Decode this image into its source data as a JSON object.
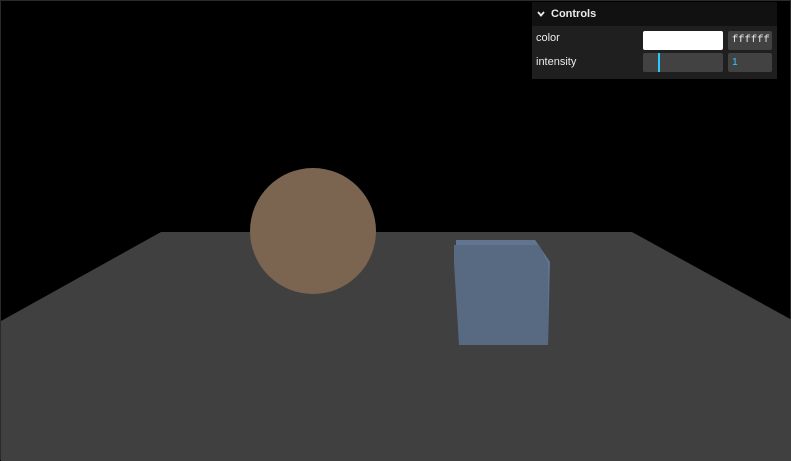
{
  "scene": {
    "background_color": "#000000",
    "floor": {
      "pattern": "checkerboard",
      "light_color": "#737373",
      "dark_color": "#404040"
    },
    "sphere": {
      "color": "#7b6450"
    },
    "cube": {
      "front_color": "#576a82",
      "side_color": "#5f7390",
      "top_color": "#617591"
    }
  },
  "gui": {
    "title": "Controls",
    "collapse_icon": "chevron-down-icon",
    "controllers": {
      "color": {
        "label": "color",
        "swatch_color": "#ffffff",
        "hex_value": "ffffff"
      },
      "intensity": {
        "label": "intensity",
        "value": "1",
        "slider_fraction": 0.2,
        "accent_color": "#2cc9ff"
      }
    }
  }
}
